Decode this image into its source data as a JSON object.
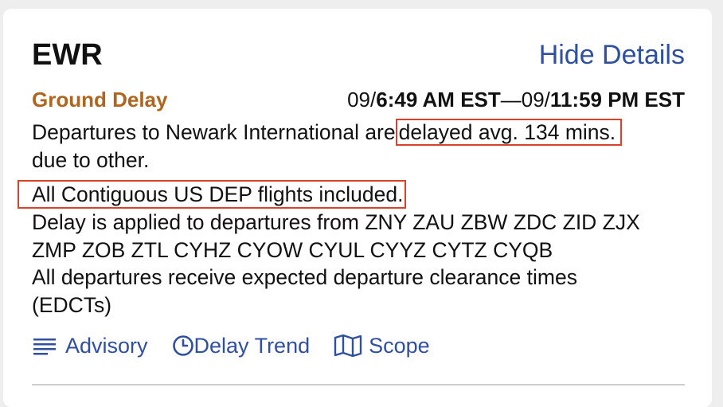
{
  "header": {
    "airport_code": "EWR",
    "hide_details_label": "Hide Details"
  },
  "program": {
    "type": "Ground Delay",
    "start_day": "09/",
    "start_time": "6:49 AM EST",
    "separator": "—",
    "end_day": "09/",
    "end_time": "11:59 PM EST"
  },
  "details": {
    "line1_prefix": "Departures to Newark International are",
    "line1_highlight": "delayed avg. 134 mins.",
    "line2": "due to other.",
    "line3_highlight": "All Contiguous US DEP flights included.",
    "line4": "Delay is applied to departures from ZNY ZAU ZBW ZDC ZID ZJX",
    "line5": "ZMP ZOB ZTL CYHZ CYOW CYUL CYYZ CYTZ CYQB",
    "line6": "All departures receive expected departure clearance times",
    "line7": "(EDCTs)"
  },
  "links": {
    "advisory_label": "Advisory",
    "advisory_icon": "lines-icon",
    "delay_trend_label": "Delay Trend",
    "delay_trend_icon": "clock-icon",
    "scope_label": "Scope",
    "scope_icon": "map-icon"
  },
  "colors": {
    "link": "#2f4f9f",
    "program": "#b0651e",
    "highlight_border": "#d9422a",
    "background": "#eeeeee",
    "card": "#ffffff"
  }
}
